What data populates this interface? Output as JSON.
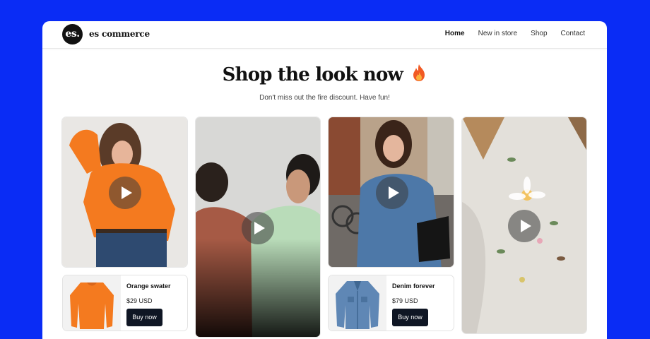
{
  "brand": {
    "logo_mark": "es.",
    "name": "es commerce"
  },
  "nav": {
    "home": "Home",
    "new_in_store": "New in store",
    "shop": "Shop",
    "contact": "Contact"
  },
  "hero": {
    "title": "Shop the look now",
    "subtitle": "Don't miss out the fire discount. Have fun!"
  },
  "products": [
    {
      "name": "Orange swater",
      "price": "$29 USD",
      "button": "Buy now"
    },
    {
      "name": "Denim forever",
      "price": "$79 USD",
      "button": "Buy now"
    }
  ],
  "colors": {
    "background": "#0a2cf5",
    "button": "#0f1624",
    "sweater": "#f47a1f",
    "denim": "#4d78a8"
  },
  "icons": [
    "fire-icon",
    "play-icon"
  ]
}
